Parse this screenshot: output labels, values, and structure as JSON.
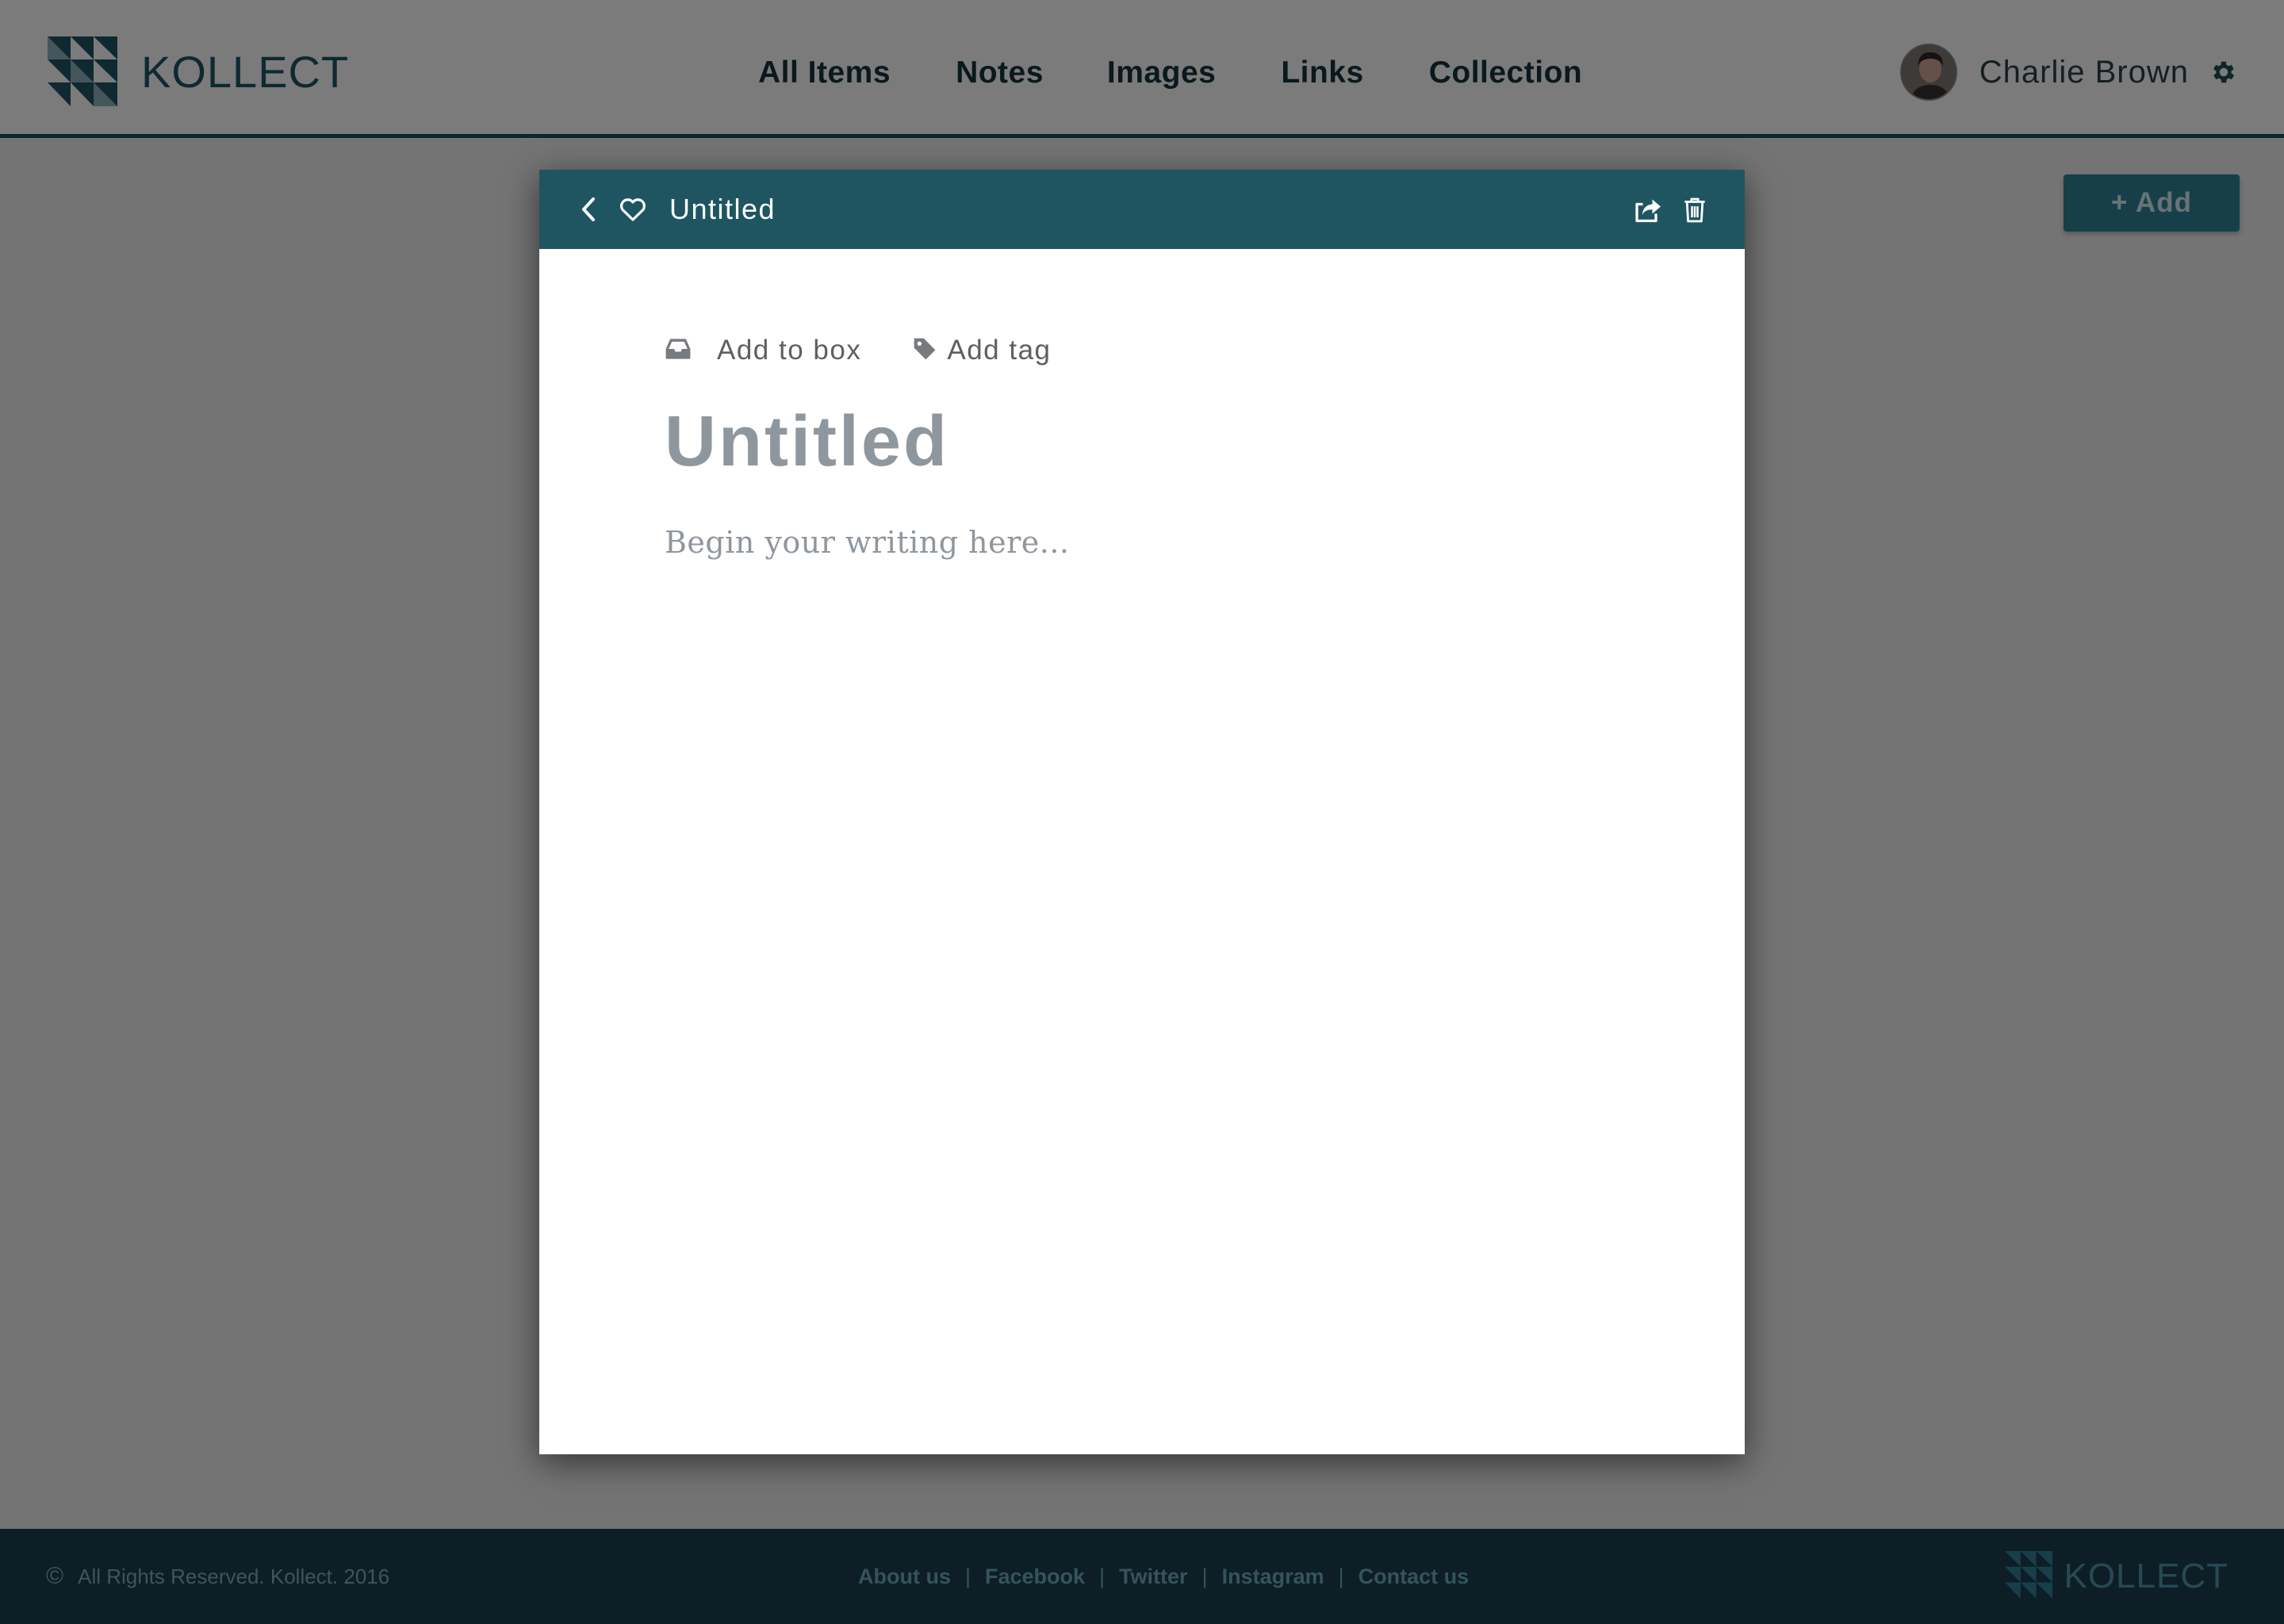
{
  "brand": {
    "name": "KOLLECT"
  },
  "nav": {
    "items": [
      {
        "label": "All Items"
      },
      {
        "label": "Notes"
      },
      {
        "label": "Images"
      },
      {
        "label": "Links"
      },
      {
        "label": "Collection"
      }
    ]
  },
  "user": {
    "name": "Charlie Brown",
    "avatar_icon": "user-avatar",
    "settings_icon": "gear-icon"
  },
  "main": {
    "add_label": "+ Add"
  },
  "modal": {
    "title": "Untitled",
    "icons": [
      "chevron-left-icon",
      "heart-icon",
      "share-icon",
      "trash-icon"
    ],
    "add_to_box_label": "Add to box",
    "add_tag_label": "Add tag",
    "doc_title": "Untitled",
    "body_placeholder": "Begin your writing here..."
  },
  "footer": {
    "copyright_symbol": "©",
    "copyright": "All Rights Reserved.  Kollect. 2016",
    "links": [
      {
        "label": "About us"
      },
      {
        "label": "Facebook"
      },
      {
        "label": "Twitter"
      },
      {
        "label": "Instagram"
      },
      {
        "label": "Contact us"
      }
    ],
    "separator": "|",
    "brand": "KOLLECT"
  },
  "colors": {
    "brand_dark": "#1e5561",
    "header_bg": "#f7f7f7",
    "footer_bg": "#1a3d4c",
    "accent": "#2f7f92"
  }
}
